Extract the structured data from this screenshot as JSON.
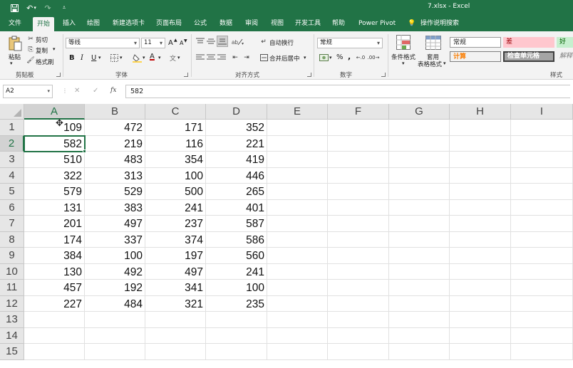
{
  "colors": {
    "brand": "#217346",
    "bad_fill": "#ffc7ce",
    "bad_text": "#9c0006",
    "good_fill": "#c6efce",
    "good_text": "#006100",
    "calc_fill": "#f2f2f2",
    "calc_text": "#fa7d00",
    "check_fill": "#a5a5a5"
  },
  "titlebar": {
    "title": "7.xlsx  -  Excel",
    "icons": [
      "save-icon",
      "undo-icon",
      "redo-icon",
      "customize-qat-icon"
    ]
  },
  "tabs": [
    "文件",
    "开始",
    "插入",
    "绘图",
    "新建选项卡",
    "页面布局",
    "公式",
    "数据",
    "审阅",
    "视图",
    "开发工具",
    "帮助",
    "Power Pivot",
    "操作说明搜索"
  ],
  "active_tab": "开始",
  "ribbon": {
    "clipboard": {
      "paste": "粘贴",
      "cut": "剪切",
      "copy": "复制",
      "format_painter": "格式刷",
      "label": "剪贴板"
    },
    "font": {
      "name": "等线",
      "size": "11",
      "bold": "B",
      "italic": "I",
      "underline": "U",
      "grow": "A",
      "shrink": "A",
      "font_color": "A",
      "label": "字体"
    },
    "alignment": {
      "wrap": "自动换行",
      "merge": "合并后居中",
      "label": "对齐方式"
    },
    "number": {
      "format": "常规",
      "percent": "%",
      "comma": ",",
      "label": "数字"
    },
    "styles": {
      "conditional": "条件格式",
      "table_line1": "套用",
      "table_line2": "表格格式",
      "normal": "常规",
      "bad": "差",
      "good": "好",
      "calc": "计算",
      "check": "检查单元格",
      "explain": "解释",
      "label": "样式"
    }
  },
  "formula_bar": {
    "name_box": "A2",
    "fx": "fx",
    "cancel": "✕",
    "enter": "✓",
    "value": "582"
  },
  "sheet": {
    "columns": [
      "A",
      "B",
      "C",
      "D",
      "E",
      "F",
      "G",
      "H",
      "I"
    ],
    "rows": [
      "1",
      "2",
      "3",
      "4",
      "5",
      "6",
      "7",
      "8",
      "9",
      "10",
      "11",
      "12",
      "13",
      "14",
      "15"
    ],
    "selected_cell": "A2",
    "data": [
      [
        109,
        472,
        171,
        352
      ],
      [
        582,
        219,
        116,
        221
      ],
      [
        510,
        483,
        354,
        419
      ],
      [
        322,
        313,
        100,
        446
      ],
      [
        579,
        529,
        500,
        265
      ],
      [
        131,
        383,
        241,
        401
      ],
      [
        201,
        497,
        237,
        587
      ],
      [
        174,
        337,
        374,
        586
      ],
      [
        384,
        100,
        197,
        560
      ],
      [
        130,
        492,
        497,
        241
      ],
      [
        457,
        192,
        341,
        100
      ],
      [
        227,
        484,
        321,
        235
      ]
    ]
  }
}
